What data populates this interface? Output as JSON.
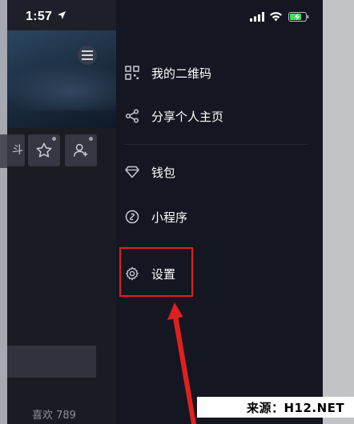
{
  "status_bar": {
    "time": "1:57",
    "location_icon": "location-arrow-icon",
    "signal_icon": "cellular-signal-icon",
    "wifi_icon": "wifi-icon",
    "battery_icon": "battery-charging-icon"
  },
  "background_profile": {
    "menu_icon": "hamburger-menu-icon",
    "partial_button_text": "斗",
    "favorite_icon": "star-icon",
    "add_friend_icon": "add-user-icon",
    "likes_text": "喜欢 789"
  },
  "drawer": {
    "items_top": [
      {
        "label": "我的二维码",
        "icon": "qr-code-icon"
      },
      {
        "label": "分享个人主页",
        "icon": "share-icon"
      }
    ],
    "items_bottom": [
      {
        "label": "钱包",
        "icon": "wallet-diamond-icon"
      },
      {
        "label": "小程序",
        "icon": "mini-program-link-icon"
      },
      {
        "label": "设置",
        "icon": "gear-icon"
      }
    ]
  },
  "annotation": {
    "highlight_color": "#e0201f",
    "arrow_icon": "red-arrow-pointer"
  },
  "watermark": {
    "text": "来源：H12.NET"
  },
  "colors": {
    "drawer_bg": "#141621",
    "text_primary": "#ffffff",
    "icon_color": "#c9cbd2",
    "annotation_red": "#e0201f"
  }
}
